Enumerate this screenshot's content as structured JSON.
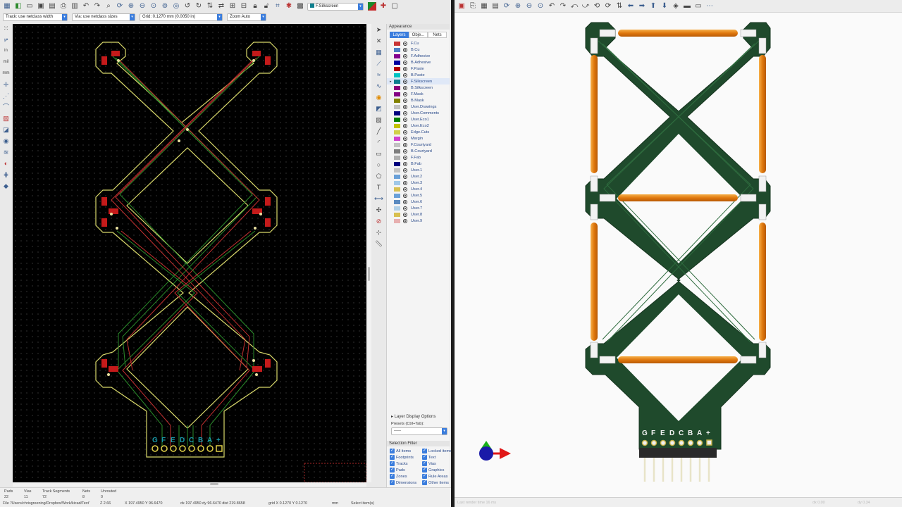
{
  "left_toolbar": {
    "track_select": "Track: use netclass width",
    "via_select": "Via: use netclass sizes",
    "grid_select": "Grid: 0.1270 mm (0.0050 in)",
    "zoom_select": "Zoom Auto",
    "layer_select": "F.Silkscreen"
  },
  "units": [
    "in",
    "mil",
    "mm"
  ],
  "appearance": {
    "title": "Appearance",
    "tabs": [
      "Layers",
      "Obje...",
      "Nets"
    ],
    "layers": [
      {
        "name": "F.Cu",
        "color": "#c83434"
      },
      {
        "name": "B.Cu",
        "color": "#4d7fc4"
      },
      {
        "name": "F.Adhesive",
        "color": "#84008e"
      },
      {
        "name": "B.Adhesive",
        "color": "#0000a0"
      },
      {
        "name": "F.Paste",
        "color": "#b40000"
      },
      {
        "name": "B.Paste",
        "color": "#00c2c2"
      },
      {
        "name": "F.Silkscreen",
        "color": "#0e7f8e"
      },
      {
        "name": "B.Silkscreen",
        "color": "#8c007c"
      },
      {
        "name": "F.Mask",
        "color": "#840084"
      },
      {
        "name": "B.Mask",
        "color": "#828200"
      },
      {
        "name": "User.Drawings",
        "color": "#c2c2c2"
      },
      {
        "name": "User.Comments",
        "color": "#00007e"
      },
      {
        "name": "User.Eco1",
        "color": "#007e00"
      },
      {
        "name": "User.Eco2",
        "color": "#c2c200"
      },
      {
        "name": "Edge.Cuts",
        "color": "#d0d04a"
      },
      {
        "name": "Margin",
        "color": "#d040d0"
      },
      {
        "name": "F.Courtyard",
        "color": "#c2c2c2"
      },
      {
        "name": "B.Courtyard",
        "color": "#7e7e7e"
      },
      {
        "name": "F.Fab",
        "color": "#afafaf"
      },
      {
        "name": "B.Fab",
        "color": "#000080"
      },
      {
        "name": "User.1",
        "color": "#c2c2c2"
      },
      {
        "name": "User.2",
        "color": "#6aa0d8"
      },
      {
        "name": "User.3",
        "color": "#a0c8e8"
      },
      {
        "name": "User.4",
        "color": "#d8c050"
      },
      {
        "name": "User.5",
        "color": "#6aa0d8"
      },
      {
        "name": "User.6",
        "color": "#5a8ac0"
      },
      {
        "name": "User.7",
        "color": "#b0d0e8"
      },
      {
        "name": "User.8",
        "color": "#d8c050"
      },
      {
        "name": "User.9",
        "color": "#e8b0b0"
      }
    ],
    "active_layer": "F.Silkscreen",
    "layer_display_options": "Layer Display Options",
    "presets_label": "Presets (Ctrl+Tab):",
    "presets_value": "-----"
  },
  "selection_filter": {
    "title": "Selection Filter",
    "items": [
      "All items",
      "Locked items",
      "Footprints",
      "Text",
      "Tracks",
      "Vias",
      "Pads",
      "Graphics",
      "Zones",
      "Rule Areas",
      "Dimensions",
      "Other items"
    ]
  },
  "connector_labels": [
    "G",
    "F",
    "E",
    "D",
    "C",
    "B",
    "A",
    "+"
  ],
  "status": {
    "pads_label": "Pads",
    "pads": "22",
    "vias_label": "Vias",
    "vias": "11",
    "tracks_label": "Track Segments",
    "tracks": "72",
    "nets_label": "Nets",
    "nets": "8",
    "unrouted_label": "Unrouted",
    "unrouted": "0",
    "file": "File '/Users/chrisgreening/Dropbox/Work/kicad/Text'",
    "z": "Z 2.66",
    "xy": "X 197.4950  Y 96.6470",
    "dxdy": "dx 197.4950  dy 96.6470  dist 219.8658",
    "grid": "grid X 0.1270  Y 0.1270",
    "unit": "mm",
    "action": "Select item(s)"
  },
  "viewer_status": {
    "render": "Last render time 16 ms",
    "dx": "dx 0.00",
    "dy": "dy 0.34"
  }
}
